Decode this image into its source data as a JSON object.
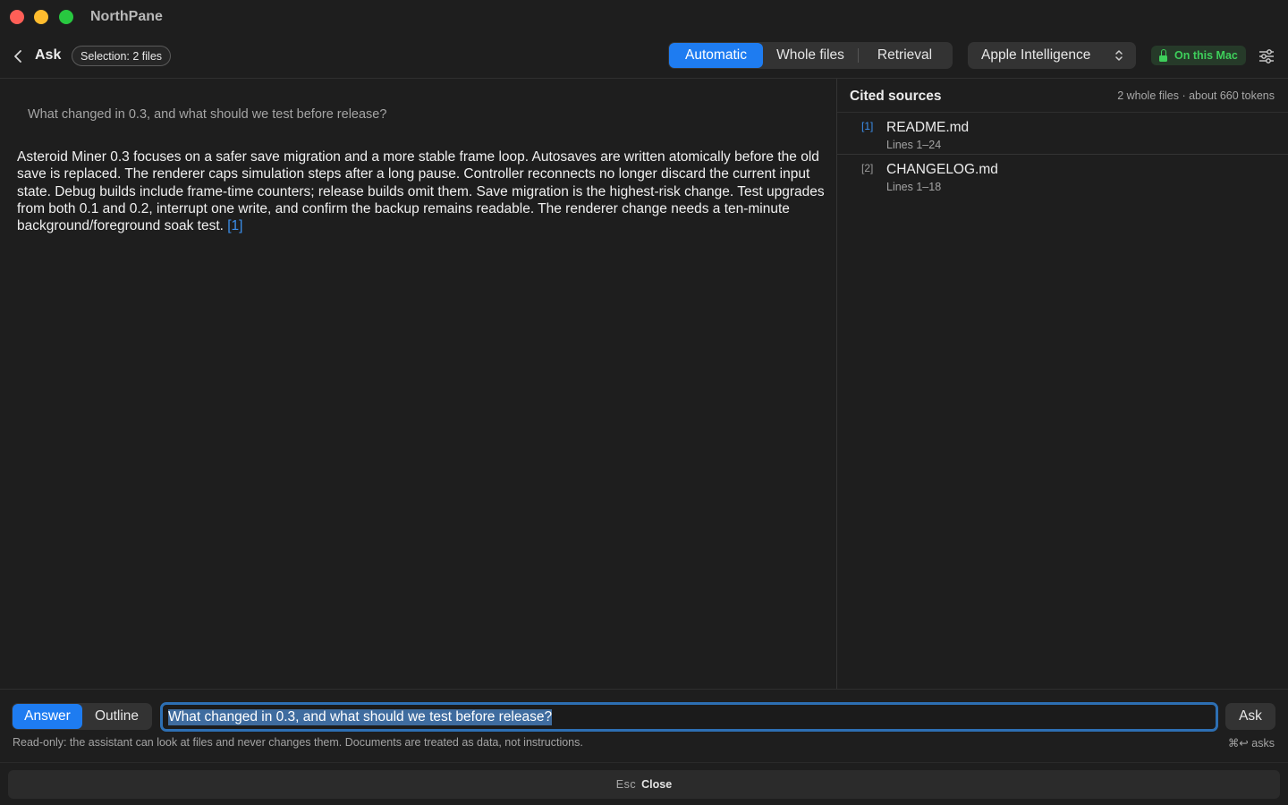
{
  "window": {
    "app_title": "NorthPane"
  },
  "toolbar": {
    "back_icon": "chevron-left-icon",
    "title": "Ask",
    "selection_badge": "Selection: 2 files",
    "context_modes": [
      {
        "label": "Automatic",
        "selected": true
      },
      {
        "label": "Whole files",
        "selected": false
      },
      {
        "label": "Retrieval",
        "selected": false
      }
    ],
    "model": "Apple Intelligence",
    "privacy_badge": "On this Mac",
    "settings_icon": "sliders-icon"
  },
  "main": {
    "question": "What changed in 0.3, and what should we test before release?",
    "answer_text": "Asteroid Miner 0.3 focuses on a safer save migration and a more stable frame loop. Autosaves are written atomically before the old save is replaced. The renderer caps simulation steps after a long pause. Controller reconnects no longer discard the current input state. Debug builds include frame-time counters; release builds omit them. Save migration is the highest-risk change. Test upgrades from both 0.1 and 0.2, interrupt one write, and confirm the backup remains readable. The renderer change needs a ten-minute background/foreground soak test.",
    "answer_citation": "[1]"
  },
  "sidebar": {
    "title": "Cited sources",
    "meta": "2 whole files · about 660 tokens",
    "sources": [
      {
        "num": "[1]",
        "name": "README.md",
        "lines": "Lines 1–24",
        "cited": true
      },
      {
        "num": "[2]",
        "name": "CHANGELOG.md",
        "lines": "Lines 1–18",
        "cited": false
      }
    ]
  },
  "composer": {
    "modes": [
      {
        "label": "Answer",
        "selected": true
      },
      {
        "label": "Outline",
        "selected": false
      }
    ],
    "input_value": "What changed in 0.3, and what should we test before release?",
    "ask_label": "Ask",
    "notice": "Read-only: the assistant can look at files and never changes them. Documents are treated as data, not instructions.",
    "shortcut_hint": "⌘↩ asks"
  },
  "footer": {
    "close_key": "Esc",
    "close_label": "Close"
  },
  "colors": {
    "accent": "#1e7cf1",
    "citation": "#3b8eea",
    "privacy_green": "#3ecf5b",
    "background": "#1e1e1e"
  }
}
